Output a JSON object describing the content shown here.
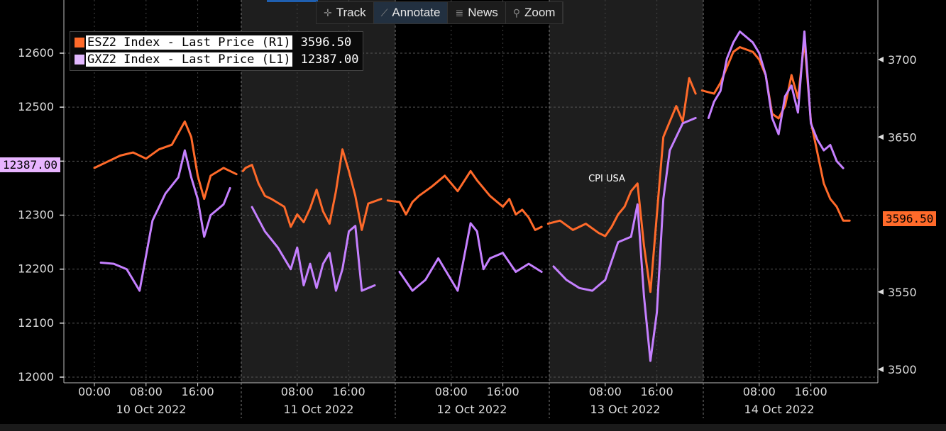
{
  "toolbar": {
    "track": "Track",
    "annotate": "Annotate",
    "news": "News",
    "zoom": "Zoom"
  },
  "legend": [
    {
      "name": "ESZ2 Index - Last Price (R1)",
      "value": "3596.50",
      "color": "#ff6a2a"
    },
    {
      "name": "GXZ2 Index - Last Price (L1)",
      "value": "12387.00",
      "color": "#d9a8ff"
    }
  ],
  "left_tag": "12387.00",
  "right_tag": "3596.50",
  "annotation": "CPI USA",
  "chart_data": {
    "type": "line",
    "left_axis": {
      "ylim": [
        11990,
        12690
      ],
      "ticks": [
        12000,
        12100,
        12200,
        12300,
        12400,
        12500,
        12600
      ],
      "labels": [
        "12000",
        "12100",
        "12200",
        "12300",
        "",
        "12500",
        "12600"
      ]
    },
    "right_axis": {
      "ylim": [
        3495,
        3720
      ],
      "ticks": [
        3500,
        3550,
        3650,
        3700
      ],
      "labels": [
        "3500",
        "3550",
        "3650",
        "3700"
      ]
    },
    "days": [
      "10 Oct 2022",
      "11 Oct 2022",
      "12 Oct 2022",
      "13 Oct 2022",
      "14 Oct 2022"
    ],
    "time_ticks": [
      {
        "day": 0,
        "hour": 0,
        "label": "00:00"
      },
      {
        "day": 0,
        "hour": 8,
        "label": "08:00"
      },
      {
        "day": 0,
        "hour": 16,
        "label": "16:00"
      },
      {
        "day": 1,
        "hour": 8,
        "label": "08:00"
      },
      {
        "day": 1,
        "hour": 16,
        "label": "16:00"
      },
      {
        "day": 2,
        "hour": 8,
        "label": "08:00"
      },
      {
        "day": 2,
        "hour": 16,
        "label": "16:00"
      },
      {
        "day": 3,
        "hour": 8,
        "label": "08:00"
      },
      {
        "day": 3,
        "hour": 16,
        "label": "16:00"
      },
      {
        "day": 4,
        "hour": 8,
        "label": "08:00"
      },
      {
        "day": 4,
        "hour": 16,
        "label": "16:00"
      }
    ],
    "series": [
      {
        "name": "ESZ2 Index - Last Price (R1)",
        "axis": "right",
        "color": "#ff6a2a",
        "segments": [
          [
            [
              0,
              0,
              3630
            ],
            [
              0,
              2,
              3634
            ],
            [
              0,
              4,
              3638
            ],
            [
              0,
              6,
              3640
            ],
            [
              0,
              8,
              3636
            ],
            [
              0,
              10,
              3642
            ],
            [
              0,
              12,
              3645
            ],
            [
              0,
              14,
              3660
            ],
            [
              0,
              15,
              3650
            ],
            [
              0,
              16,
              3625
            ],
            [
              0,
              17,
              3610
            ],
            [
              0,
              18,
              3625
            ],
            [
              0,
              20,
              3630
            ],
            [
              0,
              22,
              3626
            ]
          ],
          [
            [
              0,
              23,
              3628
            ],
            [
              1,
              0,
              3630
            ],
            [
              1,
              1,
              3632
            ],
            [
              1,
              2,
              3620
            ],
            [
              1,
              3,
              3612
            ],
            [
              1,
              4,
              3610
            ],
            [
              1,
              6,
              3605
            ],
            [
              1,
              7,
              3592
            ],
            [
              1,
              8,
              3600
            ],
            [
              1,
              9,
              3595
            ],
            [
              1,
              10,
              3604
            ],
            [
              1,
              11,
              3616
            ],
            [
              1,
              12,
              3602
            ],
            [
              1,
              13,
              3594
            ],
            [
              1,
              14,
              3615
            ],
            [
              1,
              15,
              3642
            ],
            [
              1,
              16,
              3628
            ],
            [
              1,
              17,
              3612
            ],
            [
              1,
              18,
              3590
            ],
            [
              1,
              19,
              3607
            ],
            [
              1,
              21,
              3610
            ]
          ],
          [
            [
              1,
              22,
              3609
            ],
            [
              2,
              0,
              3608
            ],
            [
              2,
              1,
              3600
            ],
            [
              2,
              2,
              3608
            ],
            [
              2,
              3,
              3612
            ],
            [
              2,
              5,
              3618
            ],
            [
              2,
              7,
              3625
            ],
            [
              2,
              9,
              3615
            ],
            [
              2,
              11,
              3628
            ],
            [
              2,
              12,
              3622
            ],
            [
              2,
              14,
              3612
            ],
            [
              2,
              16,
              3605
            ],
            [
              2,
              17,
              3610
            ],
            [
              2,
              18,
              3600
            ],
            [
              2,
              19,
              3603
            ],
            [
              2,
              20,
              3598
            ],
            [
              2,
              21,
              3590
            ],
            [
              2,
              22,
              3592
            ]
          ],
          [
            [
              2,
              23,
              3594
            ],
            [
              3,
              1,
              3596
            ],
            [
              3,
              3,
              3590
            ],
            [
              3,
              5,
              3594
            ],
            [
              3,
              7,
              3588
            ],
            [
              3,
              8,
              3586
            ],
            [
              3,
              9,
              3592
            ],
            [
              3,
              10,
              3600
            ],
            [
              3,
              11,
              3605
            ],
            [
              3,
              12,
              3615
            ],
            [
              3,
              13,
              3620
            ],
            [
              3,
              14,
              3580
            ],
            [
              3,
              15,
              3550
            ],
            [
              3,
              16,
              3600
            ],
            [
              3,
              17,
              3650
            ],
            [
              3,
              18,
              3660
            ],
            [
              3,
              19,
              3670
            ],
            [
              3,
              20,
              3660
            ],
            [
              3,
              21,
              3688
            ],
            [
              3,
              22,
              3678
            ]
          ],
          [
            [
              3,
              23,
              3680
            ],
            [
              4,
              1,
              3678
            ],
            [
              4,
              2,
              3685
            ],
            [
              4,
              3,
              3695
            ],
            [
              4,
              4,
              3705
            ],
            [
              4,
              5,
              3708
            ],
            [
              4,
              7,
              3705
            ],
            [
              4,
              8,
              3700
            ],
            [
              4,
              9,
              3690
            ],
            [
              4,
              10,
              3665
            ],
            [
              4,
              11,
              3662
            ],
            [
              4,
              12,
              3670
            ],
            [
              4,
              13,
              3690
            ],
            [
              4,
              14,
              3675
            ],
            [
              4,
              15,
              3712
            ],
            [
              4,
              16,
              3660
            ],
            [
              4,
              17,
              3640
            ],
            [
              4,
              18,
              3620
            ],
            [
              4,
              19,
              3610
            ],
            [
              4,
              20,
              3605
            ],
            [
              4,
              21,
              3596
            ],
            [
              4,
              22,
              3596
            ]
          ]
        ]
      },
      {
        "name": "GXZ2 Index - Last Price (L1)",
        "axis": "left",
        "color": "#c580ff",
        "segments": [
          [
            [
              0,
              1,
              12212
            ],
            [
              0,
              3,
              12210
            ],
            [
              0,
              5,
              12200
            ],
            [
              0,
              7,
              12160
            ],
            [
              0,
              9,
              12290
            ],
            [
              0,
              11,
              12340
            ],
            [
              0,
              13,
              12370
            ],
            [
              0,
              14,
              12420
            ],
            [
              0,
              15,
              12370
            ],
            [
              0,
              16,
              12330
            ],
            [
              0,
              17,
              12260
            ],
            [
              0,
              18,
              12300
            ],
            [
              0,
              20,
              12320
            ],
            [
              0,
              21,
              12350
            ]
          ],
          [
            [
              1,
              1,
              12315
            ],
            [
              1,
              3,
              12270
            ],
            [
              1,
              5,
              12240
            ],
            [
              1,
              7,
              12200
            ],
            [
              1,
              8,
              12240
            ],
            [
              1,
              9,
              12170
            ],
            [
              1,
              10,
              12210
            ],
            [
              1,
              11,
              12165
            ],
            [
              1,
              12,
              12210
            ],
            [
              1,
              13,
              12230
            ],
            [
              1,
              14,
              12160
            ],
            [
              1,
              15,
              12200
            ],
            [
              1,
              16,
              12270
            ],
            [
              1,
              17,
              12280
            ],
            [
              1,
              18,
              12160
            ],
            [
              1,
              20,
              12170
            ]
          ],
          [
            [
              2,
              0,
              12195
            ],
            [
              2,
              2,
              12160
            ],
            [
              2,
              4,
              12180
            ],
            [
              2,
              6,
              12220
            ],
            [
              2,
              8,
              12180
            ],
            [
              2,
              9,
              12160
            ],
            [
              2,
              11,
              12285
            ],
            [
              2,
              12,
              12270
            ],
            [
              2,
              13,
              12200
            ],
            [
              2,
              14,
              12220
            ],
            [
              2,
              16,
              12230
            ],
            [
              2,
              18,
              12195
            ],
            [
              2,
              20,
              12210
            ],
            [
              2,
              22,
              12195
            ]
          ],
          [
            [
              3,
              0,
              12205
            ],
            [
              3,
              2,
              12180
            ],
            [
              3,
              4,
              12165
            ],
            [
              3,
              6,
              12160
            ],
            [
              3,
              8,
              12180
            ],
            [
              3,
              10,
              12250
            ],
            [
              3,
              12,
              12260
            ],
            [
              3,
              13,
              12320
            ],
            [
              3,
              14,
              12150
            ],
            [
              3,
              15,
              12030
            ],
            [
              3,
              16,
              12120
            ],
            [
              3,
              17,
              12330
            ],
            [
              3,
              18,
              12420
            ],
            [
              3,
              20,
              12470
            ],
            [
              3,
              22,
              12480
            ]
          ],
          [
            [
              3,
              24,
              12480
            ],
            [
              4,
              1,
              12510
            ],
            [
              4,
              2,
              12530
            ],
            [
              4,
              3,
              12590
            ],
            [
              4,
              4,
              12620
            ],
            [
              4,
              5,
              12640
            ],
            [
              4,
              7,
              12620
            ],
            [
              4,
              8,
              12600
            ],
            [
              4,
              9,
              12560
            ],
            [
              4,
              10,
              12480
            ],
            [
              4,
              11,
              12450
            ],
            [
              4,
              12,
              12520
            ],
            [
              4,
              13,
              12540
            ],
            [
              4,
              14,
              12490
            ],
            [
              4,
              15,
              12640
            ],
            [
              4,
              16,
              12470
            ],
            [
              4,
              17,
              12440
            ],
            [
              4,
              18,
              12420
            ],
            [
              4,
              19,
              12430
            ],
            [
              4,
              20,
              12400
            ],
            [
              4,
              21,
              12387
            ]
          ]
        ]
      }
    ]
  }
}
